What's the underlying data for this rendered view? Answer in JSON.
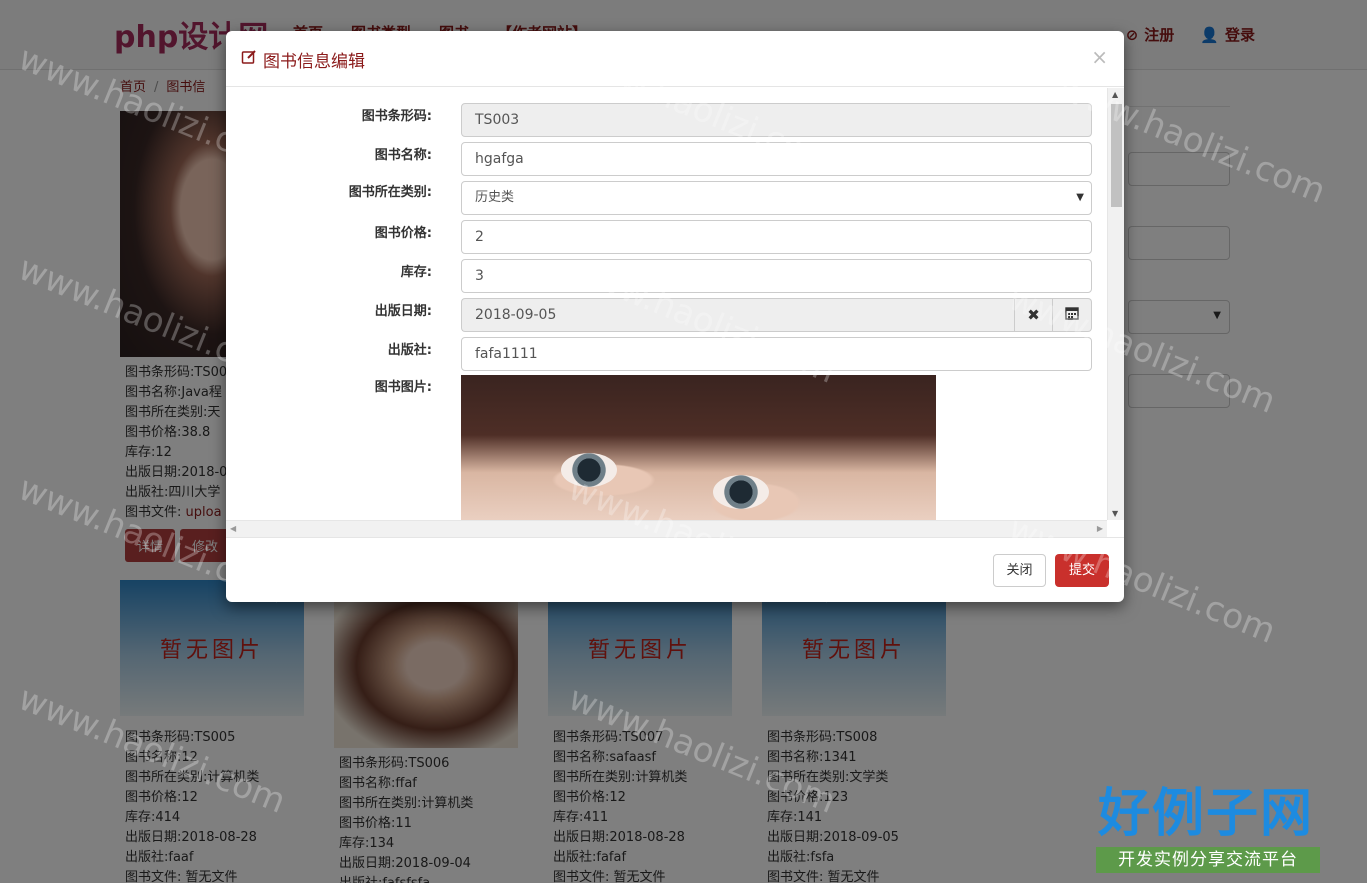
{
  "nav": {
    "brand": "php设计网",
    "items": [
      "首页",
      "图书类型",
      "图书",
      "【作者网站】"
    ],
    "register": "注册",
    "login": "登录"
  },
  "breadcrumb": {
    "home": "首页",
    "current": "图书信"
  },
  "books_top": [
    {
      "barcode": "图书条形码:TS00",
      "name": "图书名称:Java程",
      "category": "图书所在类别:天",
      "price": "图书价格:38.8",
      "stock": "库存:12",
      "date": "出版日期:2018-0",
      "publisher": "出版社:四川大学",
      "file_label": "图书文件: ",
      "file_link": "uploa",
      "detail_btn": "详情",
      "edit_btn": "修改"
    }
  ],
  "books_bottom": [
    {
      "noimg": "暂无图片",
      "barcode": "图书条形码:TS005",
      "name": "图书名称:12",
      "category": "图书所在类别:计算机类",
      "price": "图书价格:12",
      "stock": "库存:414",
      "date": "出版日期:2018-08-28",
      "publisher": "出版社:faaf",
      "file": "图书文件: 暂无文件"
    },
    {
      "barcode": "图书条形码:TS006",
      "name": "图书名称:ffaf",
      "category": "图书所在类别:计算机类",
      "price": "图书价格:11",
      "stock": "库存:134",
      "date": "出版日期:2018-09-04",
      "publisher": "出版社:fafsfsfa"
    },
    {
      "noimg": "暂无图片",
      "barcode": "图书条形码:TS007",
      "name": "图书名称:safaasf",
      "category": "图书所在类别:计算机类",
      "price": "图书价格:12",
      "stock": "库存:411",
      "date": "出版日期:2018-08-28",
      "publisher": "出版社:fafaf",
      "file": "图书文件: 暂无文件"
    },
    {
      "noimg": "暂无图片",
      "barcode": "图书条形码:TS008",
      "name": "图书名称:1341",
      "category": "图书所在类别:文学类",
      "price": "图书价格:123",
      "stock": "库存:141",
      "date": "出版日期:2018-09-05",
      "publisher": "出版社:fsfa",
      "file": "图书文件: 暂无文件"
    }
  ],
  "modal": {
    "title": "图书信息编辑",
    "close_symbol": "×",
    "fields": {
      "barcode": {
        "label": "图书条形码:",
        "value": "TS003"
      },
      "name": {
        "label": "图书名称:",
        "value": "hgafga"
      },
      "category": {
        "label": "图书所在类别:",
        "value": "历史类"
      },
      "price": {
        "label": "图书价格:",
        "value": "2"
      },
      "stock": {
        "label": "库存:",
        "value": "3"
      },
      "date": {
        "label": "出版日期:",
        "value": "2018-09-05"
      },
      "publisher": {
        "label": "出版社:",
        "value": "fafa1111"
      },
      "image": {
        "label": "图书图片:"
      }
    },
    "close_button": "关闭",
    "submit_button": "提交"
  },
  "watermark": {
    "text": "www.haolizi.com",
    "logo_top": "好例子网",
    "logo_bottom": "开发实例分享交流平台"
  },
  "colors": {
    "accent": "#8b1a1a",
    "button_red": "#c9302c",
    "readonly_bg": "#eeeeee"
  }
}
